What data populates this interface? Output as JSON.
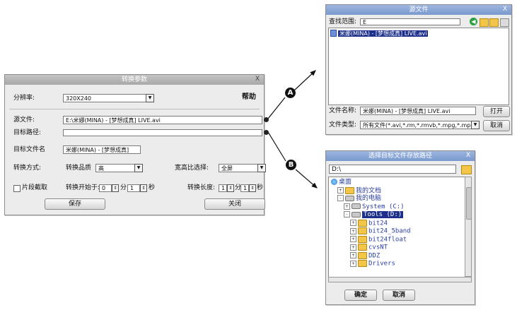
{
  "main_dialog": {
    "title": "转换参数",
    "close": "X",
    "resolution_label": "分辨率:",
    "resolution_value": "320X240",
    "help": "帮助",
    "source_label": "源文件:",
    "source_value": "E:\\米娜(MINA) - [梦想成真] LIVE.avi",
    "target_path_label": "目标路径:",
    "target_path_value": "",
    "target_name_label": "目标文件名",
    "target_name_value": "米娜(MINA) - [梦想成真]",
    "mode_label": "转换方式:",
    "mode_value": "转换品质",
    "quality_value": "高",
    "ratio_label": "宽高比选择:",
    "ratio_value": "全屏",
    "checkbox_label": "片段截取",
    "start_time_label": "转换开始于:",
    "start_min": "0",
    "minute_unit": "分",
    "start_sec": "1",
    "second_unit": "秒",
    "duration_label": "转换长度:",
    "dur_min": "1",
    "dur_sec": "1",
    "save": "保存",
    "close_button": "关闭"
  },
  "callouts": {
    "a": "A",
    "b": "B"
  },
  "source_dialog": {
    "title": "源文件",
    "close": "X",
    "range_label": "查找范围:",
    "range_value": "E",
    "file_item": "米娜(MINA) - [梦想成真] LIVE.avi",
    "filename_label": "文件名称:",
    "filename_value": "米娜(MINA) - [梦想成真] LIVE.avi",
    "open": "打开",
    "filetype_label": "文件类型:",
    "filetype_value": "所有文件(*.avi,*.rm,*.rmvb,*.mpg,*.mpe",
    "cancel": "取消"
  },
  "folder_dialog": {
    "title": "选择目标文件存放路径",
    "close": "X",
    "path_value": "D:\\",
    "tree": [
      {
        "label": "桌面",
        "type": "desktop",
        "level": 0,
        "pm": ""
      },
      {
        "label": "我的文档",
        "type": "folder",
        "level": 1,
        "pm": "+"
      },
      {
        "label": "我的电脑",
        "type": "computer",
        "level": 1,
        "pm": "-"
      },
      {
        "label": "System (C:)",
        "type": "drive",
        "level": 2,
        "pm": "+"
      },
      {
        "label": "Tools (D:)",
        "type": "drive",
        "level": 2,
        "pm": "-",
        "selected": true
      },
      {
        "label": "bit24",
        "type": "folder",
        "level": 3,
        "pm": "+"
      },
      {
        "label": "bit24_5band",
        "type": "folder",
        "level": 3,
        "pm": "+"
      },
      {
        "label": "bit24float",
        "type": "folder",
        "level": 3,
        "pm": "+"
      },
      {
        "label": "cvsNT",
        "type": "folder",
        "level": 3,
        "pm": "+"
      },
      {
        "label": "DDZ",
        "type": "folder",
        "level": 3,
        "pm": "+"
      },
      {
        "label": "Drivers",
        "type": "folder",
        "level": 3,
        "pm": "+"
      }
    ],
    "ok": "确定",
    "cancel": "取消"
  }
}
